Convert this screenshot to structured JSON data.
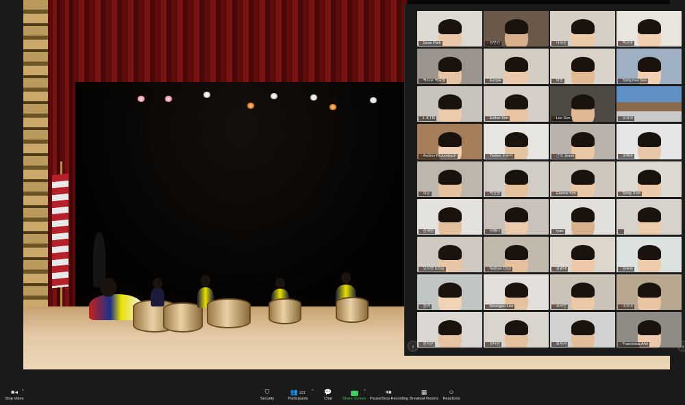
{
  "meeting": {
    "gallery_tiles": [
      {
        "name": "Sean Park",
        "bg": "#dcd8d2",
        "skin": "#e9c7a8"
      },
      {
        "name": "정연진",
        "bg": "#6b5a4c",
        "skin": "#d9b08c"
      },
      {
        "name": "나하준",
        "bg": "#d5cfc6",
        "skin": "#eccaa6"
      },
      {
        "name": "박지수",
        "bg": "#e9e4de",
        "skin": "#f1cfb0"
      },
      {
        "name": "백지현",
        "bg": "#c3bbb1",
        "skin": "#e4bf9c"
      },
      {
        "name": "백지우 백보람",
        "bg": "#9a948c",
        "skin": "#e6c3a3"
      },
      {
        "name": "Eunjae",
        "bg": "#d3cdc4",
        "skin": "#eac8a8"
      },
      {
        "name": "이승",
        "bg": "#d9d3c9",
        "skin": "#e2bb95"
      },
      {
        "name": "Sang hee Seo",
        "bg": "#9fb0c2",
        "skin": "#f0cfb2"
      },
      {
        "name": "",
        "bg": "",
        "skin": ""
      },
      {
        "name": "I. K I N",
        "bg": "#c8c3bd",
        "skin": "#eccbac"
      },
      {
        "name": "Esther Kim",
        "bg": "#d6cfc8",
        "skin": "#e8c4a3"
      },
      {
        "name": "Leo Son",
        "bg": "#4e4a43",
        "skin": "#e0b994"
      },
      {
        "name": "유유하",
        "bg": "#5f8fc4",
        "skin": ""
      },
      {
        "name": "",
        "bg": "",
        "skin": ""
      },
      {
        "name": "Audrey Rickenbach",
        "bg": "#a57d58",
        "skin": "#f0d0b4"
      },
      {
        "name": "Yoolee 조유리",
        "bg": "#e7e5e2",
        "skin": "#e6c3a1"
      },
      {
        "name": "근혁 Jease",
        "bg": "#b9b2aa",
        "skin": "#e9c6a4"
      },
      {
        "name": "조예주",
        "bg": "#e6e6e6",
        "skin": "#e8c6a8"
      },
      {
        "name": "",
        "bg": "",
        "skin": ""
      },
      {
        "name": "여은",
        "bg": "#bdb6ac",
        "skin": "#e5c19e"
      },
      {
        "name": "박진영",
        "bg": "#d1ccc6",
        "skin": "#e6c09b"
      },
      {
        "name": "Gianne Kim",
        "bg": "#cfc7bd",
        "skin": "#e9c7a7"
      },
      {
        "name": "Song Ji-oh",
        "bg": "#dedad3",
        "skin": "#ebc9aa"
      },
      {
        "name": "",
        "bg": "",
        "skin": ""
      },
      {
        "name": "신재원",
        "bg": "#e4e2de",
        "skin": "#e3bf9c"
      },
      {
        "name": "이예나",
        "bg": "#c9c2ba",
        "skin": "#eccbac"
      },
      {
        "name": "ryan",
        "bg": "#e2e0dc",
        "skin": "#d8b08b"
      },
      {
        "name": "",
        "bg": "#d7d3cc",
        "skin": "#eccbab"
      },
      {
        "name": "",
        "bg": "",
        "skin": ""
      },
      {
        "name": "오지영 (Una)",
        "bg": "#cfc9c1",
        "skin": "#e8c5a4"
      },
      {
        "name": "Nathan Choi",
        "bg": "#c2b9ad",
        "skin": "#e6c09c"
      },
      {
        "name": "김형대",
        "bg": "#dcd6cd",
        "skin": "#ebc9a9"
      },
      {
        "name": "김유온",
        "bg": "#dbe2df",
        "skin": "#ecccad"
      },
      {
        "name": "",
        "bg": "",
        "skin": ""
      },
      {
        "name": "윤아",
        "bg": "#bfc6c4",
        "skin": "#f2d3b6"
      },
      {
        "name": "Seungjoo Lee",
        "bg": "#e2dfda",
        "skin": "#e6c19e"
      },
      {
        "name": "조리안",
        "bg": "#cbc3b7",
        "skin": "#ebc8a7"
      },
      {
        "name": "이주아",
        "bg": "#b8a88f",
        "skin": "#e9c5a3"
      },
      {
        "name": "",
        "bg": "",
        "skin": ""
      },
      {
        "name": "윤지은",
        "bg": "#dad7d2",
        "skin": "#e6c3a2"
      },
      {
        "name": "정다은",
        "bg": "#d9d4cc",
        "skin": "#e5c09d"
      },
      {
        "name": "최서서",
        "bg": "#d1d1d1",
        "skin": "#e2bd99"
      },
      {
        "name": "Francesca Ahn",
        "bg": "#8f8c86",
        "skin": "#ebc9aa"
      },
      {
        "name": "",
        "bg": "",
        "skin": ""
      }
    ],
    "participants_count": "221"
  },
  "toolbar": {
    "stop_video": "Stop Video",
    "security": "Security",
    "participants": "Participants",
    "chat": "Chat",
    "share_screen": "Share Screen",
    "pause_recording": "Pause/Stop Recording",
    "breakout_rooms": "Breakout Rooms",
    "reactions": "Reactions"
  },
  "icons": {
    "video": "video-camera-icon",
    "security": "shield-icon",
    "participants": "people-icon",
    "chat": "chat-bubble-icon",
    "share": "share-arrow-icon",
    "record": "pause-icon",
    "breakout": "grid-icon",
    "reactions": "smiley-plus-icon",
    "prev": "chevron-left-icon",
    "next": "chevron-right-icon"
  },
  "colors": {
    "accent_green": "#3ec95a",
    "accent_blue": "#2d8cff",
    "mic_muted_red": "#e0322e"
  }
}
